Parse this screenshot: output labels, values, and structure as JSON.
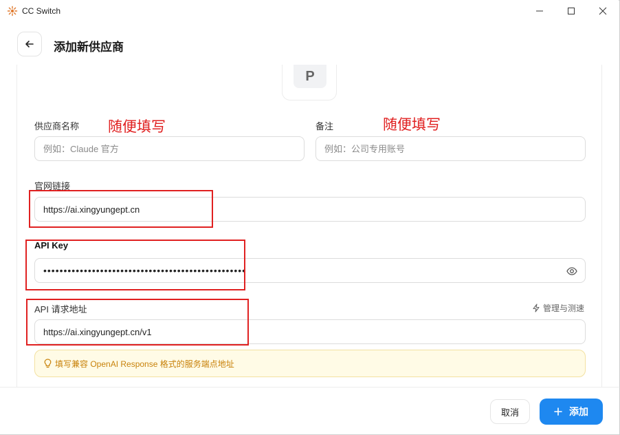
{
  "window": {
    "title": "CC Switch"
  },
  "header": {
    "title": "添加新供应商"
  },
  "logo": {
    "letter": "P"
  },
  "form": {
    "provider_name": {
      "label": "供应商名称",
      "value": "",
      "placeholder": "例如：Claude 官方"
    },
    "note": {
      "label": "备注",
      "value": "",
      "placeholder": "例如：公司专用账号"
    },
    "website": {
      "label": "官网链接",
      "value": "https://ai.xingyungept.cn"
    },
    "api_key": {
      "label": "API Key",
      "value": "••••••••••••••••••••••••••••••••••••••••••••••••••"
    },
    "api_url": {
      "label": "API 请求地址",
      "value": "https://ai.xingyungept.cn/v1",
      "manage_label": "管理与测速"
    },
    "tip": "填写兼容 OpenAI Response 格式的服务端点地址"
  },
  "annotations": {
    "name_hint": "随便填写",
    "note_hint": "随便填写",
    "color": "#e02020"
  },
  "footer": {
    "cancel_label": "取消",
    "add_label": "添加"
  },
  "colors": {
    "accent": "#1e88f0",
    "tip_text": "#c8820a",
    "tip_bg": "#fffbe6"
  }
}
